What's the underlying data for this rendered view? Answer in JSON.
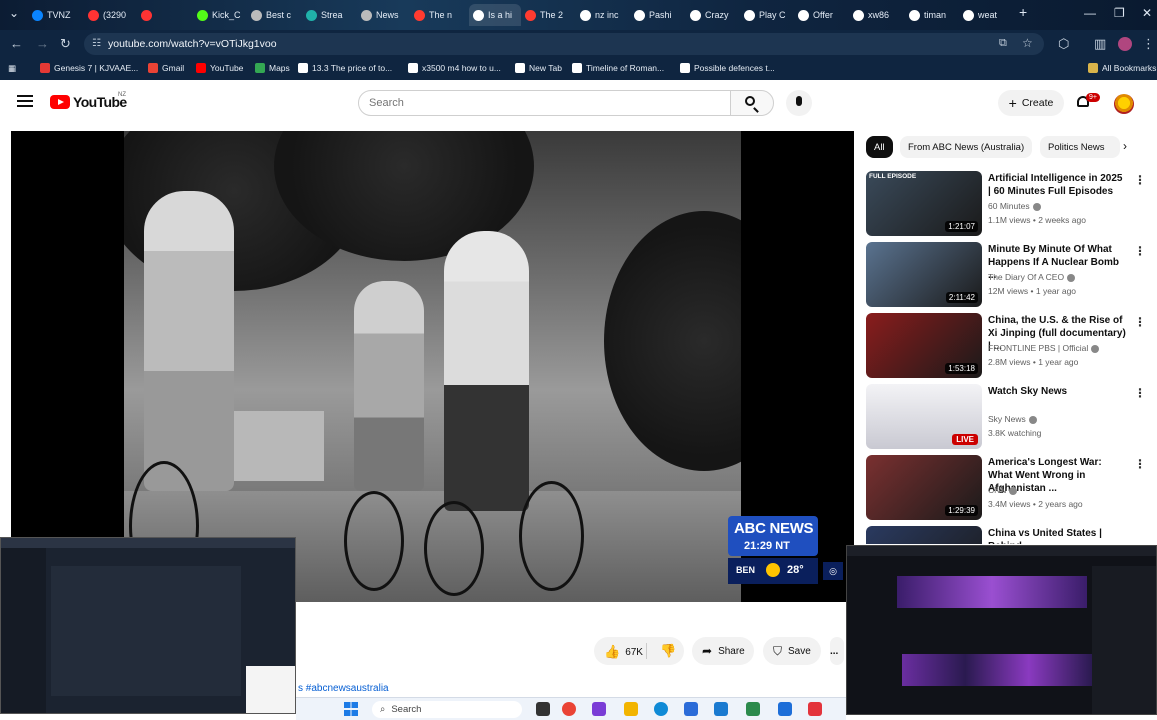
{
  "browser": {
    "tabs": [
      {
        "label": "TVNZ",
        "color": "#0a84ff"
      },
      {
        "label": "(3290",
        "color": "#ff3333"
      },
      {
        "label": "",
        "color": "#ff3333"
      },
      {
        "label": "Kick_C",
        "color": "#53fc18"
      },
      {
        "label": "Best c",
        "color": "#bbbbbb"
      },
      {
        "label": "Strea",
        "color": "#20b2aa"
      },
      {
        "label": "News",
        "color": "#bbbbbb"
      },
      {
        "label": "The n",
        "color": "#ff3b30"
      },
      {
        "label": "Is a hi",
        "color": "#ffffff"
      },
      {
        "label": "The 2",
        "color": "#ff3b30"
      },
      {
        "label": "nz inc",
        "color": "#ffffff"
      },
      {
        "label": "Pashi",
        "color": "#ffffff"
      },
      {
        "label": "Crazy",
        "color": "#ffffff"
      },
      {
        "label": "Play C",
        "color": "#ffffff"
      },
      {
        "label": "Offer",
        "color": "#ffffff"
      },
      {
        "label": "xw86",
        "color": "#ffffff"
      },
      {
        "label": "timan",
        "color": "#ffffff"
      },
      {
        "label": "weat",
        "color": "#ffffff"
      }
    ],
    "new_tab": "+",
    "url": "youtube.com/watch?v=vOTiJkg1voo",
    "bookmarks": [
      {
        "label": "Genesis 7 | KJVAAE...",
        "color": "#e53935"
      },
      {
        "label": "Gmail",
        "color": "#ea4335"
      },
      {
        "label": "YouTube",
        "color": "#ff0000"
      },
      {
        "label": "Maps",
        "color": "#34a853"
      },
      {
        "label": "13.3 The price of to...",
        "color": "#ffffff"
      },
      {
        "label": "x3500 m4 how to u...",
        "color": "#ffffff"
      },
      {
        "label": "New Tab",
        "color": "#ffffff"
      },
      {
        "label": "Timeline of Roman...",
        "color": "#ffffff"
      },
      {
        "label": "Possible defences t...",
        "color": "#ffffff"
      }
    ],
    "all_bookmarks": "All Bookmarks"
  },
  "youtube": {
    "wordmark": "YouTube",
    "region": "NZ",
    "search_placeholder": "Search",
    "create_label": "Create",
    "notif_count": "9+"
  },
  "player": {
    "news_logo": "ABC NEWS",
    "news_time": "21:29 NT",
    "weather_city": "BEN",
    "weather_temp": "28°"
  },
  "actions": {
    "likes": "67K",
    "share": "Share",
    "save": "Save",
    "more": "...",
    "hashtags": "s #abcnewsaustralia"
  },
  "chips": [
    {
      "label": "All",
      "active": true
    },
    {
      "label": "From ABC News (Australia)",
      "active": false
    },
    {
      "label": "Politics News",
      "active": false
    }
  ],
  "recommendations": [
    {
      "title": "Artificial Intelligence in 2025 | 60 Minutes Full Episodes",
      "channel": "60 Minutes",
      "meta": "1.1M views • 2 weeks ago",
      "duration": "1:21:07",
      "tag": "FULL EPISODE",
      "thumb": "#3a4a5a"
    },
    {
      "title": "Minute By Minute Of What Happens If A Nuclear Bomb ...",
      "channel": "The Diary Of A CEO",
      "meta": "12M views • 1 year ago",
      "duration": "2:11:42",
      "tag": "",
      "thumb": "#5a7390"
    },
    {
      "title": "China, the U.S. & the Rise of Xi Jinping (full documentary) | ...",
      "channel": "FRONTLINE PBS | Official",
      "meta": "2.8M views • 1 year ago",
      "duration": "1:53:18",
      "tag": "",
      "thumb": "#8a1c1c"
    },
    {
      "title": "Watch Sky News",
      "channel": "Sky News",
      "meta": "3.8K watching",
      "duration": "LIVE",
      "tag": "",
      "thumb": "#e6e6ea"
    },
    {
      "title": "America's Longest War: What Went Wrong in Afghanistan ...",
      "channel": "CNN",
      "meta": "3.4M views • 2 years ago",
      "duration": "1:29:39",
      "tag": "",
      "thumb": "#7a3030"
    },
    {
      "title": "China vs United States | Behind",
      "channel": "",
      "meta": "",
      "duration": "",
      "tag": "",
      "thumb": "#2a3a60"
    }
  ],
  "taskbar": {
    "search": "Search"
  }
}
